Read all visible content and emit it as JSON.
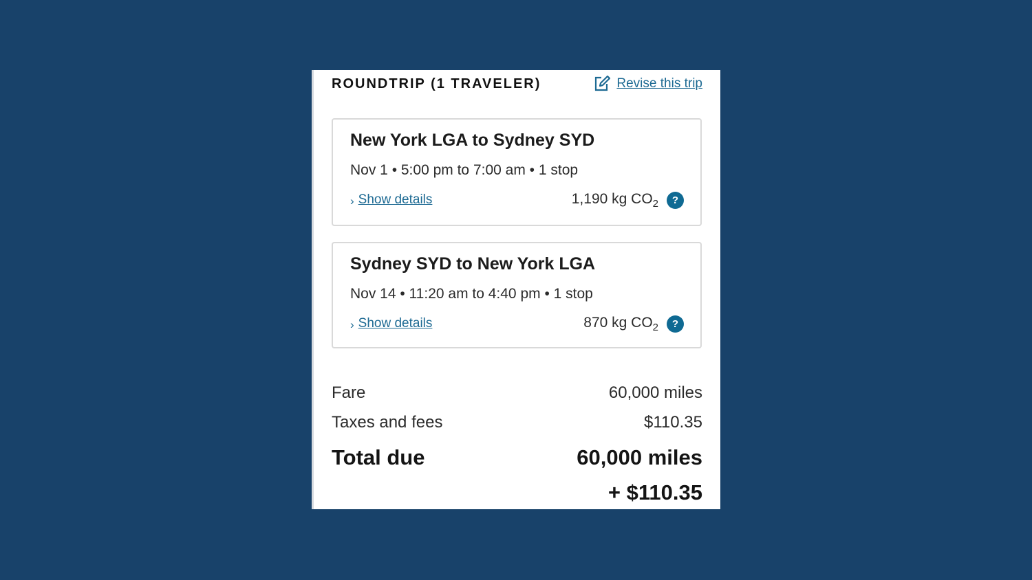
{
  "header": {
    "title": "ROUNDTRIP (1 TRAVELER)",
    "revise_label": "Revise this trip"
  },
  "flights": [
    {
      "route": "New York LGA to Sydney SYD",
      "schedule": "Nov 1 • 5:00 pm to 7:00 am • 1 stop",
      "details_label": "Show details",
      "emissions_value": "1,190 kg CO",
      "emissions_sub": "2",
      "help_symbol": "?"
    },
    {
      "route": "Sydney SYD to New York LGA",
      "schedule": "Nov 14 • 11:20 am to 4:40 pm • 1 stop",
      "details_label": "Show details",
      "emissions_value": "870 kg CO",
      "emissions_sub": "2",
      "help_symbol": "?"
    }
  ],
  "pricing": {
    "fare_label": "Fare",
    "fare_value": "60,000 miles",
    "taxes_label": "Taxes and fees",
    "taxes_value": "$110.35",
    "total_label": "Total due",
    "total_miles": "60,000 miles",
    "total_cash": "+ $110.35"
  },
  "colors": {
    "background": "#18426a",
    "link": "#1d6a93",
    "help_icon": "#0f6a93"
  },
  "icons": {
    "edit": "edit-icon",
    "chevron": "chevron-right-icon",
    "help": "help-icon"
  }
}
